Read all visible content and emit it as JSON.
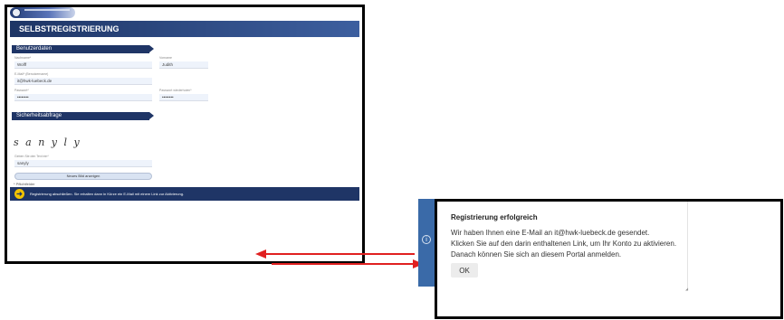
{
  "registration_form": {
    "title": "SELBSTREGISTRIERUNG",
    "section_user_data": "Benutzerdaten",
    "lastname_label": "Nachname*",
    "lastname_value": "Wolff",
    "firstname_label": "Vorname",
    "firstname_value": "Judith",
    "email_label": "E-Mail* (Benutzername)",
    "email_value": "it@hwk-luebeck.de",
    "password_label": "Passwort*",
    "password_value": "••••••••",
    "password_repeat_label": "Passwort wiederholen*",
    "password_repeat_value": "••••••••",
    "section_security": "Sicherheitsabfrage",
    "captcha_text": "s a n y l y",
    "captcha_input_label": "Geben Sie den Text ein*",
    "captcha_input_value": "sanyly",
    "new_image_button": "Neues Bild anzeigen",
    "required_note": "* Pflichtfelder",
    "submit_text": "Registrierung abschließen. Sie erhalten dann in Kürze ein E-Mail mit einem Link zur Aktivierung."
  },
  "success_dialog": {
    "title": "Registrierung erfolgreich",
    "line1": "Wir haben Ihnen eine E-Mail an it@hwk-luebeck.de gesendet.",
    "line2": "Klicken Sie auf den darin enthaltenen Link, um Ihr Konto zu aktivieren.",
    "line3": "Danach können Sie sich an diesem Portal anmelden.",
    "ok_button": "OK"
  },
  "colors": {
    "brand_navy": "#1f3566",
    "accent_yellow": "#f2c300",
    "connector_red": "#e02020"
  },
  "icons": {
    "submit": "arrow-right-circle-icon",
    "info": "info-icon"
  }
}
